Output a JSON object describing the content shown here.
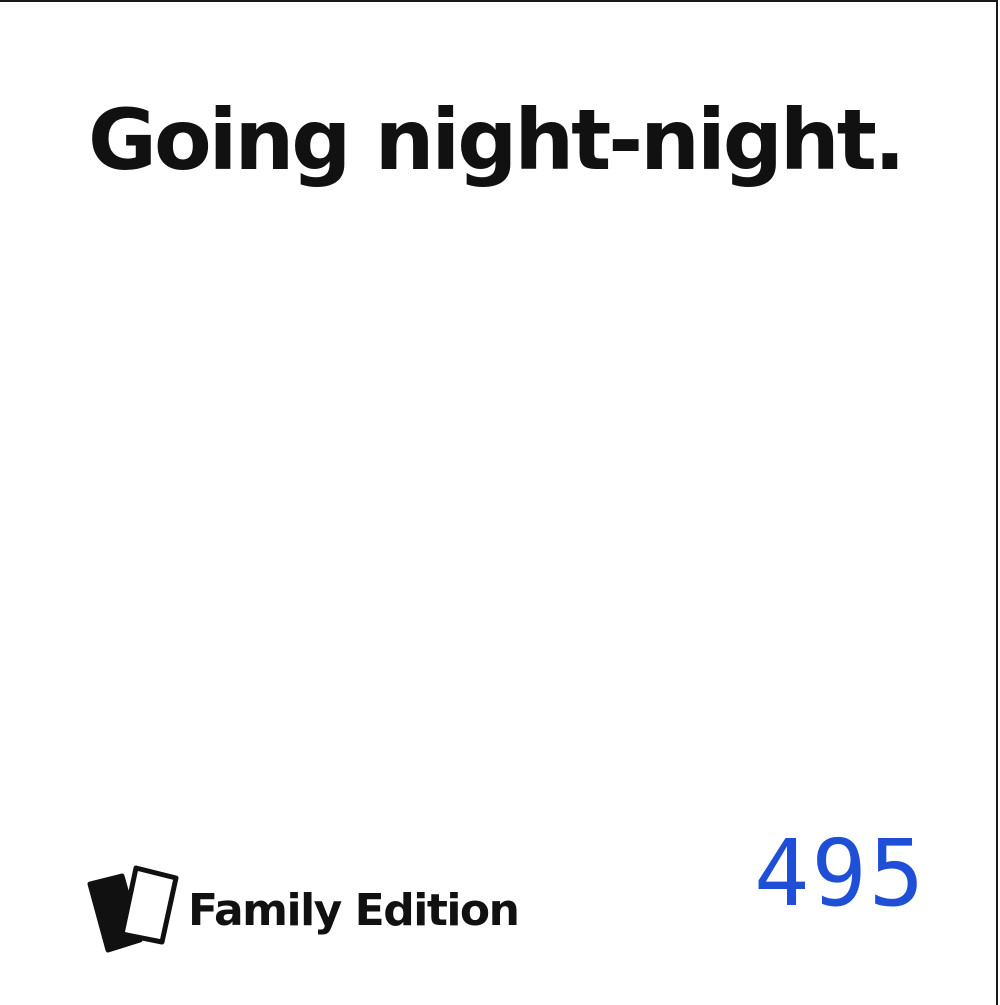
{
  "card": {
    "text": "Going night-night.",
    "edition_label": "Family Edition",
    "number": "495",
    "logo_icon": "stacked-cards-icon",
    "colors": {
      "text": "#111111",
      "number": "#1e4fd6",
      "background": "#ffffff"
    }
  }
}
